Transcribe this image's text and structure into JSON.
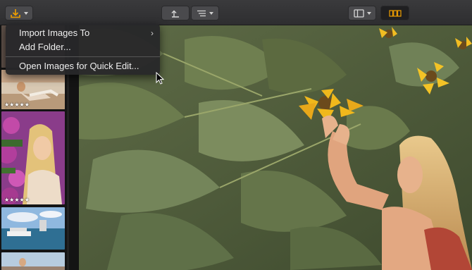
{
  "toolbar": {
    "import_button_icon": "import-arrow-icon",
    "back_button_icon": "return-arrow-icon",
    "sort_button_icon": "list-sort-icon",
    "view_button_icon": "panel-layout-icon",
    "filmstrip_button_icon": "filmstrip-icon",
    "accent_color": "#f0a000"
  },
  "import_menu": {
    "items": [
      {
        "label": "Import Images To",
        "has_submenu": true
      },
      {
        "label": "Add Folder..."
      },
      {
        "label": "Open Images for Quick Edit..."
      }
    ]
  },
  "filmstrip": {
    "thumbnails": [
      {
        "subject": "partial-top",
        "rating": ""
      },
      {
        "subject": "woman-on-beach-chair",
        "rating": "★★★★★"
      },
      {
        "subject": "woman-with-purple-flowers",
        "rating": "★★★★★"
      },
      {
        "subject": "harbor-cruise-ship",
        "rating": ""
      },
      {
        "subject": "partial-bottom",
        "rating": ""
      }
    ]
  },
  "main_photo": {
    "subject": "woman-reaching-sunflower-field"
  }
}
